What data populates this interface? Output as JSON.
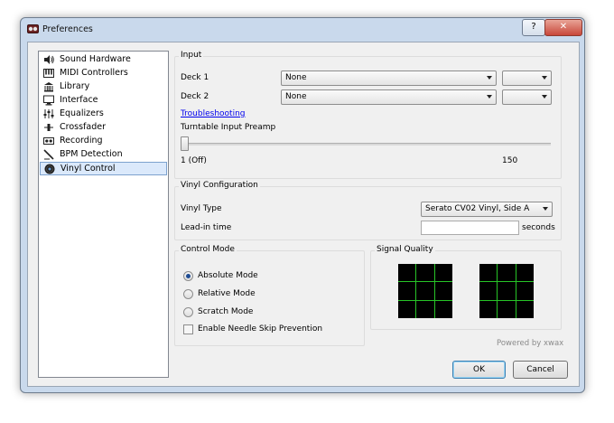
{
  "window": {
    "title": "Preferences",
    "help_label": "?",
    "close_label": "✕"
  },
  "sidebar": {
    "items": [
      {
        "label": "Sound Hardware",
        "icon": "speaker-icon"
      },
      {
        "label": "MIDI Controllers",
        "icon": "midi-keyboard-icon"
      },
      {
        "label": "Library",
        "icon": "library-icon"
      },
      {
        "label": "Interface",
        "icon": "monitor-icon"
      },
      {
        "label": "Equalizers",
        "icon": "equalizer-icon"
      },
      {
        "label": "Crossfader",
        "icon": "crossfader-icon"
      },
      {
        "label": "Recording",
        "icon": "recording-icon"
      },
      {
        "label": "BPM Detection",
        "icon": "bpm-detection-icon"
      },
      {
        "label": "Vinyl Control",
        "icon": "vinyl-icon"
      }
    ],
    "selected": "Vinyl Control"
  },
  "input": {
    "title": "Input",
    "deck1_label": "Deck 1",
    "deck1_value": "None",
    "deck1_channel": "",
    "deck2_label": "Deck 2",
    "deck2_value": "None",
    "deck2_channel": "",
    "troubleshooting": "Troubleshooting",
    "preamp_label": "Turntable Input Preamp",
    "preamp_min": "1 (Off)",
    "preamp_max": "150",
    "preamp_value": 1
  },
  "vinyl_config": {
    "title": "Vinyl Configuration",
    "type_label": "Vinyl Type",
    "type_value": "Serato CV02 Vinyl, Side A",
    "leadin_label": "Lead-in time",
    "leadin_value": "",
    "leadin_unit": "seconds"
  },
  "control_mode": {
    "title": "Control Mode",
    "options": [
      "Absolute Mode",
      "Relative Mode",
      "Scratch Mode"
    ],
    "selected": "Absolute Mode",
    "needle_skip_label": "Enable Needle Skip Prevention",
    "needle_skip_checked": false
  },
  "signal_quality": {
    "title": "Signal Quality",
    "grid_color": "#27c427"
  },
  "footer": {
    "powered_by": "Powered by xwax",
    "ok_label": "OK",
    "cancel_label": "Cancel"
  }
}
